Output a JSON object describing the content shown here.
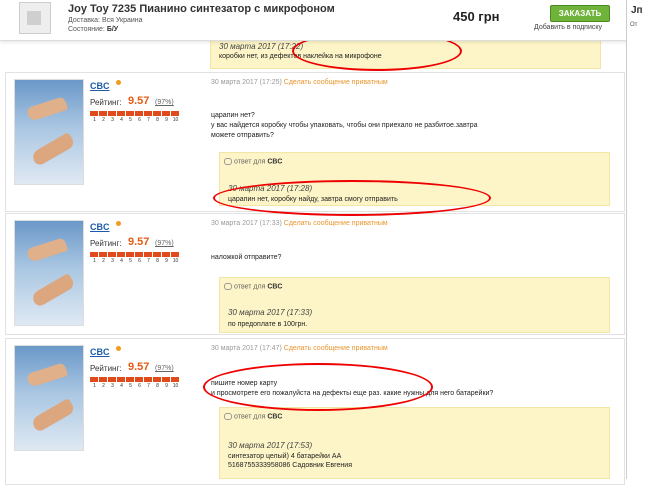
{
  "header": {
    "title": "Joy Toy 7235 Пианино синтезатор с микрофоном",
    "delivery_label": "Доставка:",
    "delivery_value": "Вся Украина",
    "condition_label": "Состояние:",
    "condition_value": "Б/У",
    "price": "450 грн",
    "order_button": "ЗАКАЗАТЬ",
    "subscribe": "Добавить в подписку",
    "right_title": "Jп",
    "right_sub": "От"
  },
  "top_reply": {
    "date": "30 марта 2017 (17:22)",
    "text": "коробки нет, из дефектов наклейка на микрофоне"
  },
  "posts": [
    {
      "user": {
        "name": "CBC",
        "rating_label": "Рейтинг:",
        "rating": "9.57",
        "rating_pct": "(97%)"
      },
      "date": "30 марта 2017 (17:25)",
      "private_link": "Сделать сообщение приватным",
      "text": [
        "царапин нет?",
        "у вас найдется коробку чтобы упаковать, чтобы они приехало не разбитое.завтра",
        "можете отправить?"
      ],
      "reply": {
        "label": "ответ для",
        "to": "CBC",
        "date": "30 марта 2017 (17:28)",
        "text": [
          "царапин нет, коробку найду, завтра смогу отправить"
        ]
      }
    },
    {
      "user": {
        "name": "CBC",
        "rating_label": "Рейтинг:",
        "rating": "9.57",
        "rating_pct": "(97%)"
      },
      "date": "30 марта 2017 (17:33)",
      "private_link": "Сделать сообщение приватным",
      "text": [
        "наложкой отправите?"
      ],
      "reply": {
        "label": "ответ для",
        "to": "CBC",
        "date": "30 марта 2017 (17:33)",
        "text": [
          "по предоплате в 100грн."
        ]
      }
    },
    {
      "user": {
        "name": "CBC",
        "rating_label": "Рейтинг:",
        "rating": "9.57",
        "rating_pct": "(97%)"
      },
      "date": "30 марта 2017 (17:47)",
      "private_link": "Сделать сообщение приватным",
      "text": [
        "пишите номер карту",
        "и просмотрете его пожалуйста на дефекты еще раз. какие нужны для него батарейки?"
      ],
      "reply": {
        "label": "ответ для",
        "to": "CBC",
        "date": "30 марта 2017 (17:53)",
        "text": [
          "синтезатор целый) 4 батарейки АА",
          "5168755333958086 Садовник Евгения"
        ]
      }
    }
  ],
  "rating_scale": [
    "1",
    "2",
    "3",
    "4",
    "5",
    "6",
    "7",
    "8",
    "9",
    "10"
  ],
  "colors": {
    "accent_orange": "#e8962e",
    "rating_red": "#e14a1a",
    "reply_bg": "#fdf5c7",
    "annotation_red": "#e00000"
  }
}
